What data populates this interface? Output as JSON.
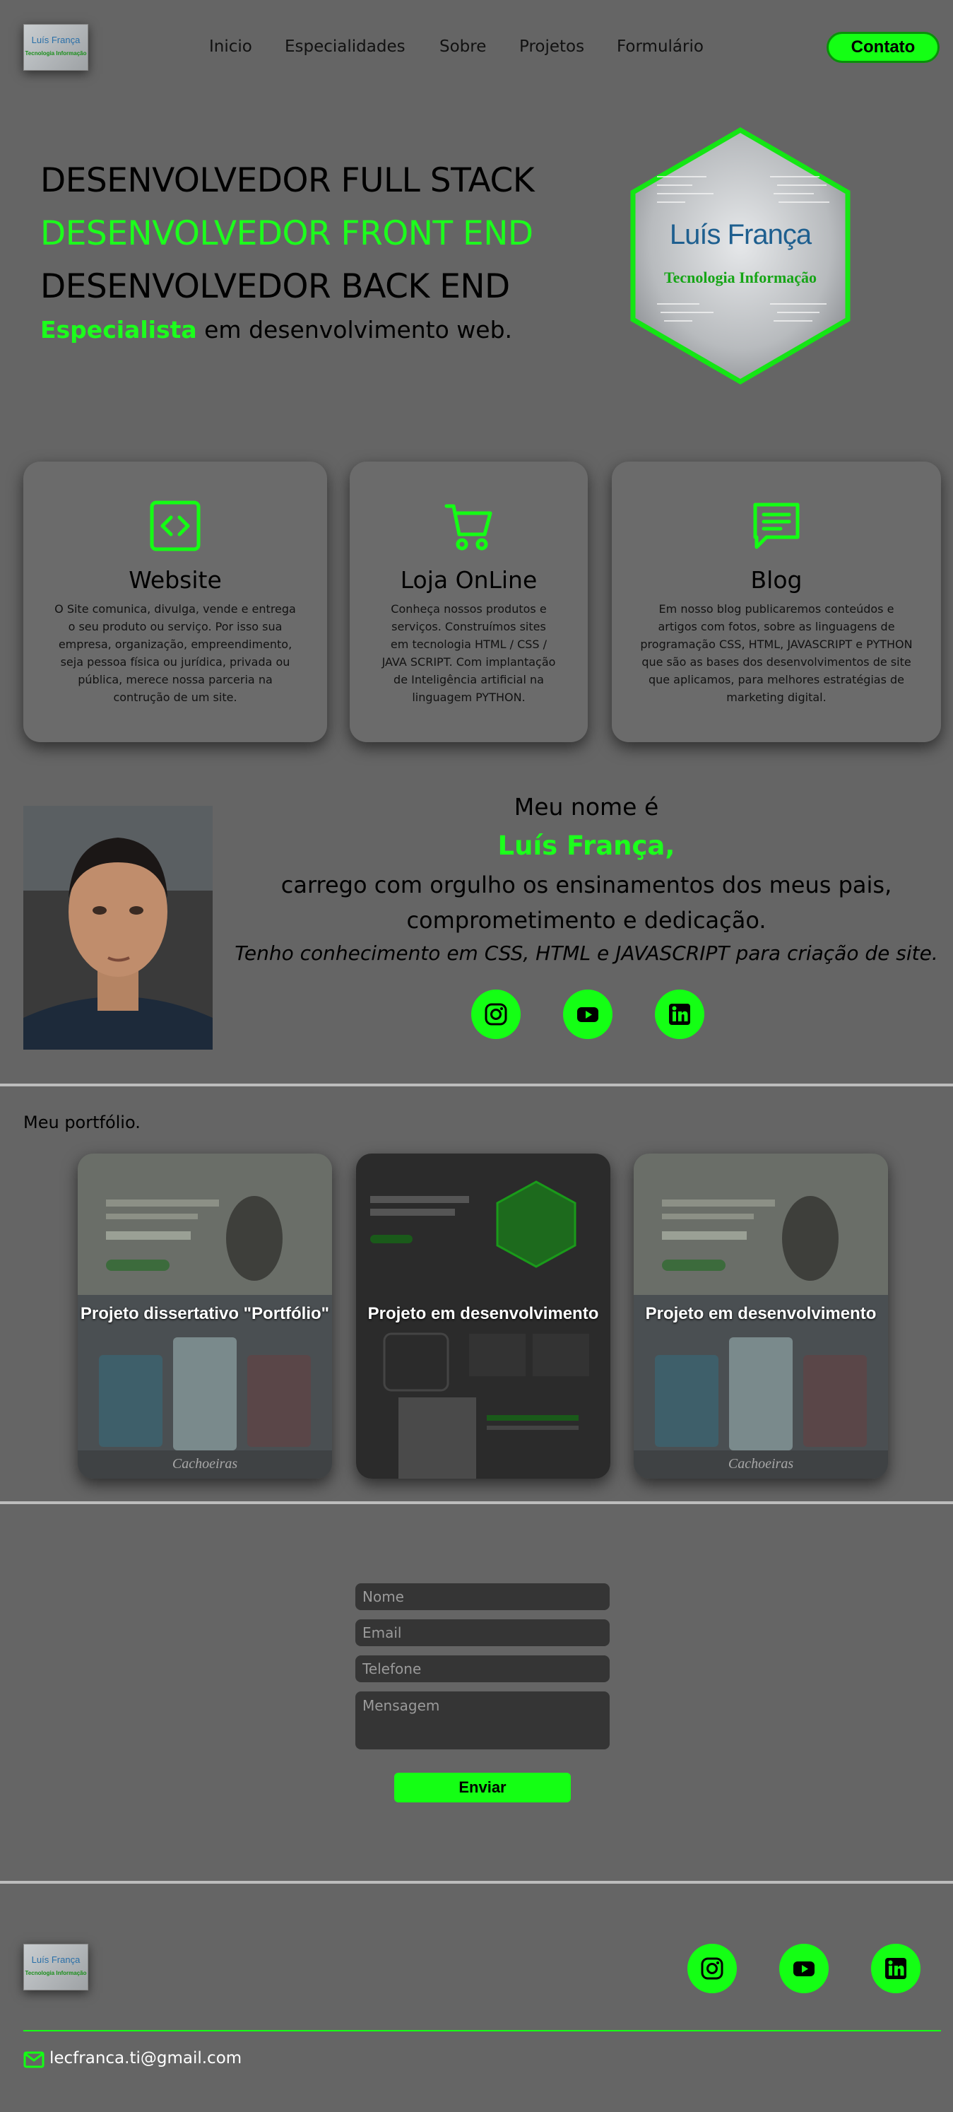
{
  "header": {
    "logo": {
      "line1": "Luís França",
      "line2": "Tecnologia Informação"
    },
    "nav": [
      "Inicio",
      "Especialidades",
      "Sobre",
      "Projetos",
      "Formulário"
    ],
    "contact_label": "Contato"
  },
  "hero": {
    "line1": "DESENVOLVEDOR FULL STACK",
    "line2": "DESENVOLVEDOR FRONT END",
    "line3": "DESENVOLVEDOR BACK END",
    "sub_highlight": "Especialista",
    "sub_rest": " em desenvolvimento web.",
    "badge": {
      "name": "Luís França",
      "tagline": "Tecnologia Informação"
    }
  },
  "cards": [
    {
      "icon": "code-icon",
      "title": "Website",
      "text": "O Site comunica, divulga, vende e entrega o seu produto ou serviço. Por isso sua empresa, organização, empreendimento, seja pessoa física ou jurídica, privada ou pública, merece nossa parceria na contrução de um site."
    },
    {
      "icon": "cart-icon",
      "title": "Loja OnLine",
      "text": "Conheça nossos produtos e serviços. Construímos sites em tecnologia HTML / CSS / JAVA SCRIPT. Com implantação de Inteligência artificial na linguagem PYTHON."
    },
    {
      "icon": "chat-icon",
      "title": "Blog",
      "text": "Em nosso blog publicaremos conteúdos e artigos com fotos, sobre as linguagens de programação CSS, HTML, JAVASCRIPT e PYTHON que são as bases dos desenvolvimentos de site que aplicamos, para melhores estratégias de marketing digital."
    }
  ],
  "about": {
    "intro": "Meu nome é",
    "name": "Luís França,",
    "line1": "carrego com orgulho os ensinamentos dos meus pais,",
    "line2": "comprometimento e dedicação.",
    "line3": "Tenho conhecimento em CSS, HTML e JAVASCRIPT para criação de site."
  },
  "social": [
    "instagram-icon",
    "youtube-icon",
    "linkedin-icon"
  ],
  "portfolio": {
    "heading": "Meu portfólio.",
    "items": [
      {
        "title": "Projeto dissertativo \"Portfólio\"",
        "thumb_caption": "Cachoeiras"
      },
      {
        "title": "Projeto em desenvolvimento",
        "thumb_caption": ""
      },
      {
        "title": "Projeto em desenvolvimento",
        "thumb_caption": "Cachoeiras"
      }
    ]
  },
  "form": {
    "name_placeholder": "Nome",
    "email_placeholder": "Email",
    "phone_placeholder": "Telefone",
    "message_placeholder": "Mensagem",
    "submit_label": "Enviar"
  },
  "footer": {
    "email": "lecfranca.ti@gmail.com"
  },
  "colors": {
    "accent": "#14ff14",
    "background": "#656565"
  }
}
